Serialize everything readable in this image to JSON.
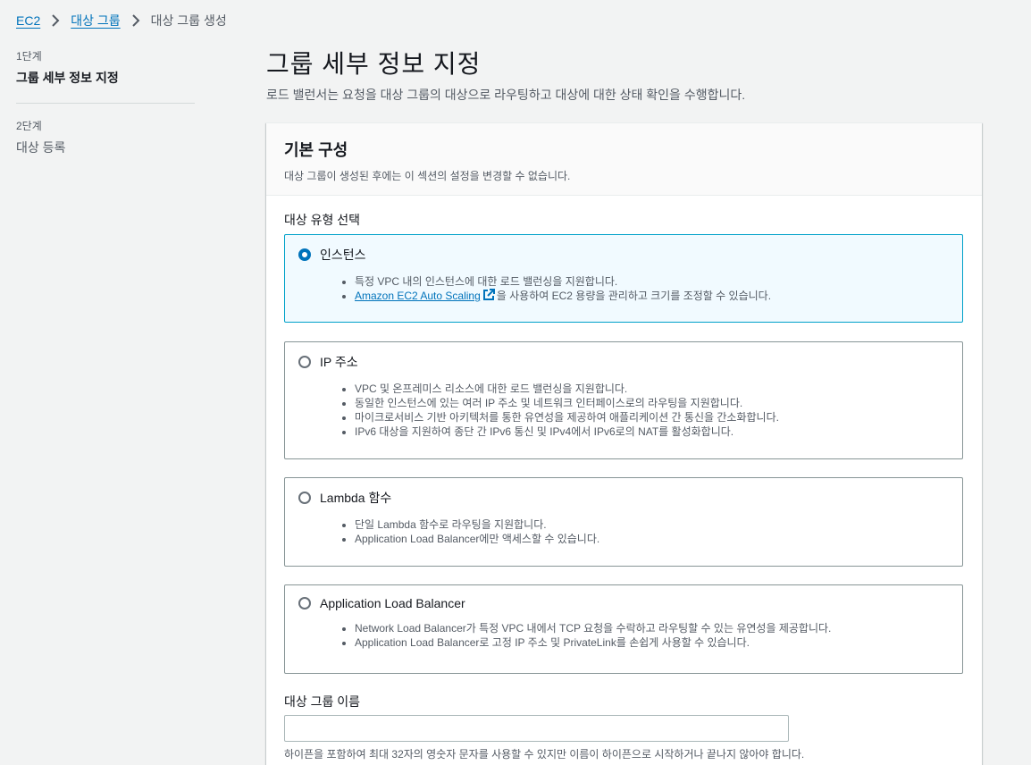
{
  "breadcrumb": {
    "items": [
      "EC2",
      "대상 그룹"
    ],
    "current": "대상 그룹 생성"
  },
  "steps": [
    {
      "label": "1단계",
      "name": "그룹 세부 정보 지정"
    },
    {
      "label": "2단계",
      "name": "대상 등록"
    }
  ],
  "header": {
    "title": "그룹 세부 정보 지정",
    "description": "로드 밸런서는 요청을 대상 그룹의 대상으로 라우팅하고 대상에 대한 상태 확인을 수행합니다."
  },
  "basic_config": {
    "title": "기본 구성",
    "subtitle": "대상 그룹이 생성된 후에는 이 섹션의 설정을 변경할 수 없습니다.",
    "target_type_label": "대상 유형 선택",
    "options": [
      {
        "title": "인스턴스",
        "selected": true,
        "bullets": [
          "특정 VPC 내의 인스턴스에 대한 로드 밸런싱을 지원합니다."
        ],
        "link_bullet": {
          "link_text": "Amazon EC2 Auto Scaling",
          "rest": "을 사용하여 EC2 용량을 관리하고 크기를 조정할 수 있습니다."
        }
      },
      {
        "title": "IP 주소",
        "selected": false,
        "bullets": [
          "VPC 및 온프레미스 리소스에 대한 로드 밸런싱을 지원합니다.",
          "동일한 인스턴스에 있는 여러 IP 주소 및 네트워크 인터페이스로의 라우팅을 지원합니다.",
          "마이크로서비스 기반 아키텍처를 통한 유연성을 제공하여 애플리케이션 간 통신을 간소화합니다.",
          "IPv6 대상을 지원하여 종단 간 IPv6 통신 및 IPv4에서 IPv6로의 NAT를 활성화합니다."
        ]
      },
      {
        "title": "Lambda 함수",
        "selected": false,
        "bullets": [
          "단일 Lambda 함수로 라우팅을 지원합니다.",
          "Application Load Balancer에만 액세스할 수 있습니다."
        ]
      },
      {
        "title": "Application Load Balancer",
        "selected": false,
        "bullets": [
          "Network Load Balancer가 특정 VPC 내에서 TCP 요청을 수락하고 라우팅할 수 있는 유연성을 제공합니다.",
          "Application Load Balancer로 고정 IP 주소 및 PrivateLink를 손쉽게 사용할 수 있습니다."
        ]
      }
    ],
    "name_label": "대상 그룹 이름",
    "name_value": "",
    "name_hint": "하이픈을 포함하여 최대 32자의 영숫자 문자를 사용할 수 있지만 이름이 하이픈으로 시작하거나 끝나지 않아야 합니다."
  }
}
